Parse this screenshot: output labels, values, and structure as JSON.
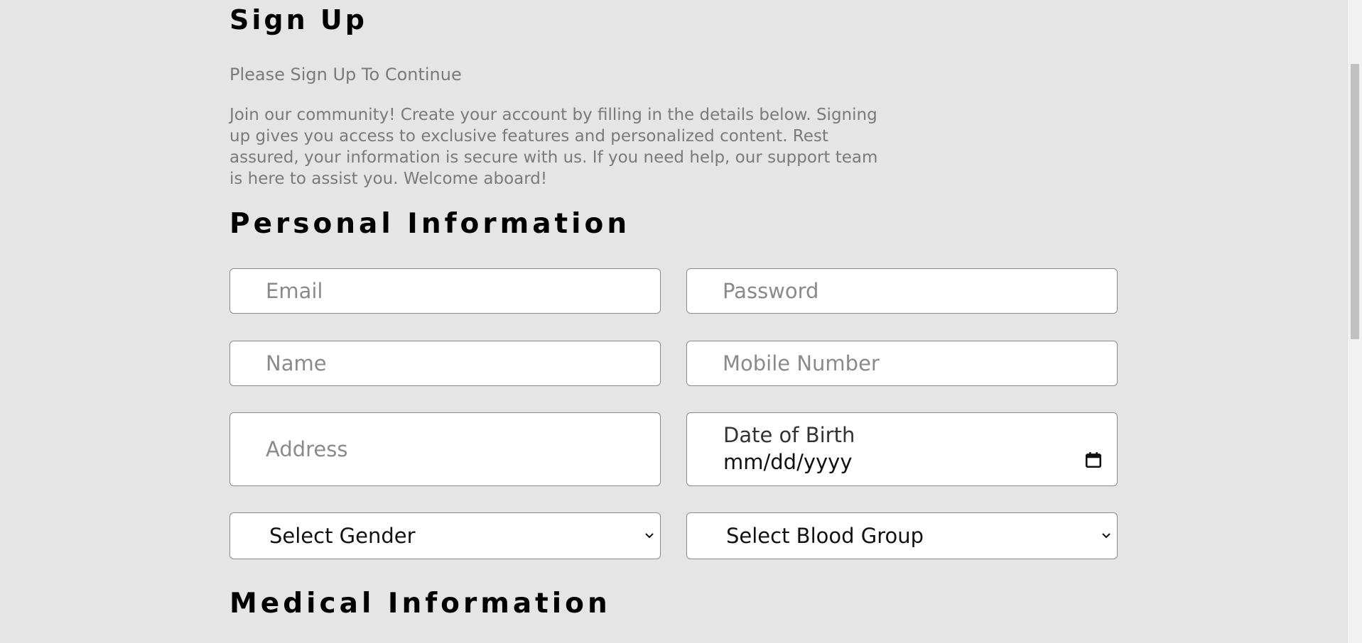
{
  "header": {
    "title": "Sign Up",
    "subtitle": "Please Sign Up To Continue",
    "intro": "Join our community! Create your account by filling in the details below. Signing up gives you access to exclusive features and personalized content. Rest assured, your information is secure with us. If you need help, our support team is here to assist you. Welcome aboard!"
  },
  "sections": {
    "personal_title": "Personal Information",
    "medical_title": "Medical Information"
  },
  "form": {
    "email_placeholder": "Email",
    "password_placeholder": "Password",
    "name_placeholder": "Name",
    "mobile_placeholder": "Mobile Number",
    "address_placeholder": "Address",
    "dob_label": "Date of Birth",
    "dob_value": "mm/dd/yyyy",
    "gender_selected": "Select Gender",
    "blood_group_selected": "Select Blood Group"
  },
  "icons": {
    "calendar": "calendar-icon",
    "chevron": "chevron-down-icon"
  }
}
